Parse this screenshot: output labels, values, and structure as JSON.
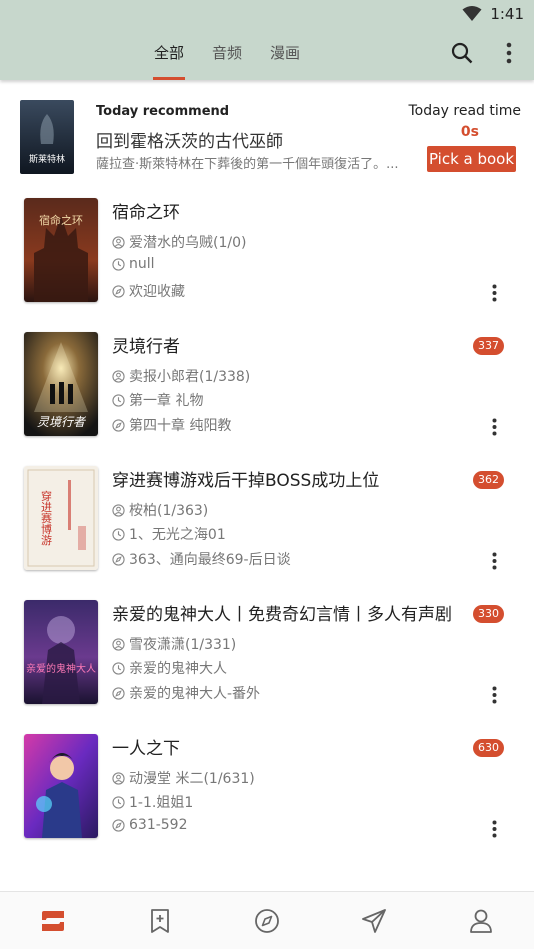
{
  "status": {
    "time": "1:41"
  },
  "tabs": [
    {
      "label": "全部"
    },
    {
      "label": "音频"
    },
    {
      "label": "漫画"
    }
  ],
  "recommend": {
    "heading": "Today recommend",
    "title": "回到霍格沃茨的古代巫師",
    "desc": "薩拉查·斯萊特林在下葬後的第一千個年頭復活了。...",
    "cover_text": "斯莱特林",
    "read_time_label": "Today read time",
    "read_time": "0s",
    "pick_label": "Pick a book"
  },
  "books": [
    {
      "title": "宿命之环",
      "author": "爱潜水的乌贼(1/0)",
      "latest": "null",
      "progress": "欢迎收藏",
      "badge": "",
      "cover_text": "宿命之环"
    },
    {
      "title": "灵境行者",
      "author": "卖报小郎君(1/338)",
      "latest": "第一章 礼物",
      "progress": "第四十章 纯阳教",
      "badge": "337",
      "cover_text": "灵境行者"
    },
    {
      "title": "穿进赛博游戏后干掉BOSS成功上位",
      "author": "桉柏(1/363)",
      "latest": "1、无光之海01",
      "progress": "363、通向最终69-后日谈",
      "badge": "362",
      "cover_text": "穿进赛博游"
    },
    {
      "title": "亲爱的鬼神大人丨免费奇幻言情丨多人有声剧",
      "author": "雪夜潇潇(1/331)",
      "latest": "亲爱的鬼神大人",
      "progress": "亲爱的鬼神大人-番外",
      "badge": "330",
      "cover_text": "亲爱的鬼神大人"
    },
    {
      "title": "一人之下",
      "author": "动漫堂 米二(1/631)",
      "latest": "1-1.姐姐1",
      "progress": "631-592",
      "badge": "630",
      "cover_text": ""
    }
  ],
  "bottom_nav": [
    {
      "icon": "bookshelf-icon"
    },
    {
      "icon": "bookmark-add-icon"
    },
    {
      "icon": "compass-icon"
    },
    {
      "icon": "send-icon"
    },
    {
      "icon": "person-icon"
    }
  ],
  "colors": {
    "accent": "#d44e2f",
    "topbar": "#c7d7cc"
  }
}
